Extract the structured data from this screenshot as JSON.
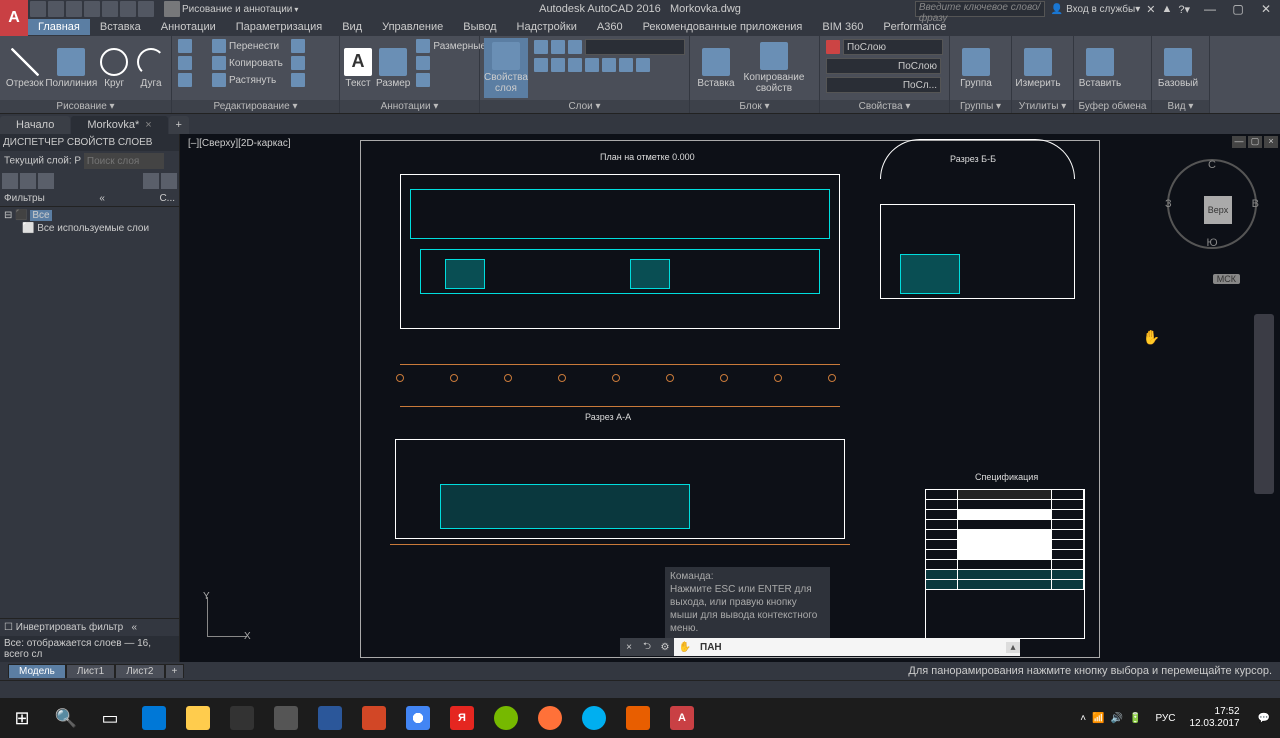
{
  "app": {
    "title_vendor": "Autodesk AutoCAD 2016",
    "title_file": "Morkovka.dwg",
    "search_placeholder": "Введите ключевое слово/фразу",
    "signin": "Вход в службы"
  },
  "qat_workspace": "Рисование и аннотации",
  "menu": [
    "Главная",
    "Вставка",
    "Аннотации",
    "Параметризация",
    "Вид",
    "Управление",
    "Вывод",
    "Надстройки",
    "A360",
    "Рекомендованные приложения",
    "BIM 360",
    "Performance"
  ],
  "ribbon": {
    "draw": {
      "label": "Рисование ▾",
      "line": "Отрезок",
      "pline": "Полилиния",
      "circle": "Круг",
      "arc": "Дуга"
    },
    "modify": {
      "label": "Редактирование ▾",
      "move": "Перенести",
      "copy": "Копировать",
      "stretch": "Растянуть"
    },
    "annot": {
      "label": "Аннотации ▾",
      "text": "Текст",
      "dim": "Размер",
      "dimlinear": "Размерные"
    },
    "layers": {
      "label": "Слои ▾",
      "props": "Свойства\nслоя"
    },
    "block": {
      "label": "Блок ▾",
      "insert": "Вставка",
      "copyprops": "Копирование\nсвойств"
    },
    "props": {
      "label": "Свойства ▾",
      "bylayer1": "ПоСлою",
      "bylayer2": "ПоСлою",
      "bylayer3": "ПоСл..."
    },
    "groups": {
      "label": "Группы ▾",
      "group": "Группа"
    },
    "utils": {
      "label": "Утилиты ▾",
      "measure": "Измерить"
    },
    "clip": {
      "label": "Буфер обмена",
      "paste": "Вставить"
    },
    "view": {
      "label": "Вид ▾",
      "base": "Базовый"
    }
  },
  "tabs": {
    "start": "Начало",
    "file": "Morkovka*"
  },
  "layer_panel": {
    "title": "ДИСПЕТЧЕР СВОЙСТВ СЛОЕВ",
    "current": "Текущий слой: Р",
    "search": "Поиск слоя",
    "filters": "Фильтры",
    "filters_col": "С...",
    "all": "Все",
    "allused": "Все используемые слои",
    "invert": "Инвертировать фильтр",
    "status": "Все: отображается слоев — 16, всего сл"
  },
  "viewport": "[–][Сверху][2D-каркас]",
  "drawing": {
    "plan": "План на отметке 0.000",
    "secAA": "Разрез А-А",
    "secBB": "Разрез Б-Б",
    "spec": "Спецификация"
  },
  "viewcube": {
    "top": "Верх",
    "n": "С",
    "s": "Ю",
    "e": "В",
    "w": "З",
    "msk": "МСК"
  },
  "cmd": {
    "prompt": "Команда:",
    "hist": "Нажмите ESC или ENTER для выхода, или правую кнопку мыши для вывода контекстного меню.",
    "current": "ПАН"
  },
  "model_tabs": [
    "Модель",
    "Лист1",
    "Лист2"
  ],
  "status": "Для панорамирования нажмите кнопку выбора и перемещайте курсор.",
  "taskbar": {
    "lang": "РУС",
    "time": "17:52",
    "date": "12.03.2017"
  },
  "ucs": {
    "x": "X",
    "y": "Y"
  }
}
